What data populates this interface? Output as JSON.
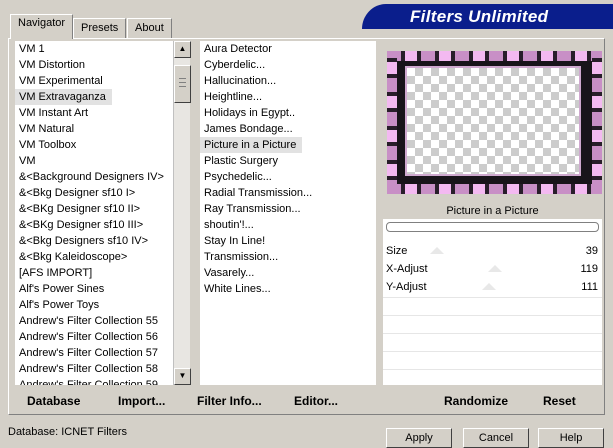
{
  "brand": "Filters Unlimited",
  "tabs": [
    "Navigator",
    "Presets",
    "About"
  ],
  "categories": [
    "VM 1",
    "VM Distortion",
    "VM Experimental",
    "VM Extravaganza",
    "VM Instant Art",
    "VM Natural",
    "VM Toolbox",
    "VM",
    "&<Background Designers IV>",
    "&<Bkg Designer sf10 I>",
    "&<BKg Designer sf10 II>",
    "&<BKg Designer sf10 III>",
    "&<Bkg Designers sf10 IV>",
    "&<Bkg Kaleidoscope>",
    "[AFS IMPORT]",
    "Alf's Power Sines",
    "Alf's Power Toys",
    "Andrew's Filter Collection 55",
    "Andrew's Filter Collection 56",
    "Andrew's Filter Collection 57",
    "Andrew's Filter Collection 58",
    "Andrew's Filter Collection 59"
  ],
  "selected_category": "VM Extravaganza",
  "filters": [
    "Aura Detector",
    "Cyberdelic...",
    "Hallucination...",
    "Heightline...",
    "Holidays in Egypt..",
    "James Bondage...",
    "Picture in a Picture",
    "Plastic Surgery",
    "Psychedelic...",
    "Radial Transmission...",
    "Ray Transmission...",
    "shoutin'!...",
    "Stay In Line!",
    "Transmission...",
    "Vasarely...",
    "White Lines..."
  ],
  "selected_filter": "Picture in a Picture",
  "filter_name": "Picture in a Picture",
  "params": [
    {
      "label": "Size",
      "value": "39",
      "fraction": 0.15
    },
    {
      "label": "X-Adjust",
      "value": "119",
      "fraction": 0.47
    },
    {
      "label": "Y-Adjust",
      "value": "111",
      "fraction": 0.44
    }
  ],
  "buttons": {
    "database": "Database",
    "import": "Import...",
    "filter_info": "Filter Info...",
    "editor": "Editor...",
    "randomize": "Randomize",
    "reset": "Reset"
  },
  "status": "Database:  ICNET Filters",
  "dialog": {
    "apply": "Apply",
    "cancel": "Cancel",
    "help": "Help"
  },
  "colors": {
    "brand_bg": "#0a1e8c",
    "face": "#d4d0c8",
    "frame_pink": "#f3b9f1"
  }
}
